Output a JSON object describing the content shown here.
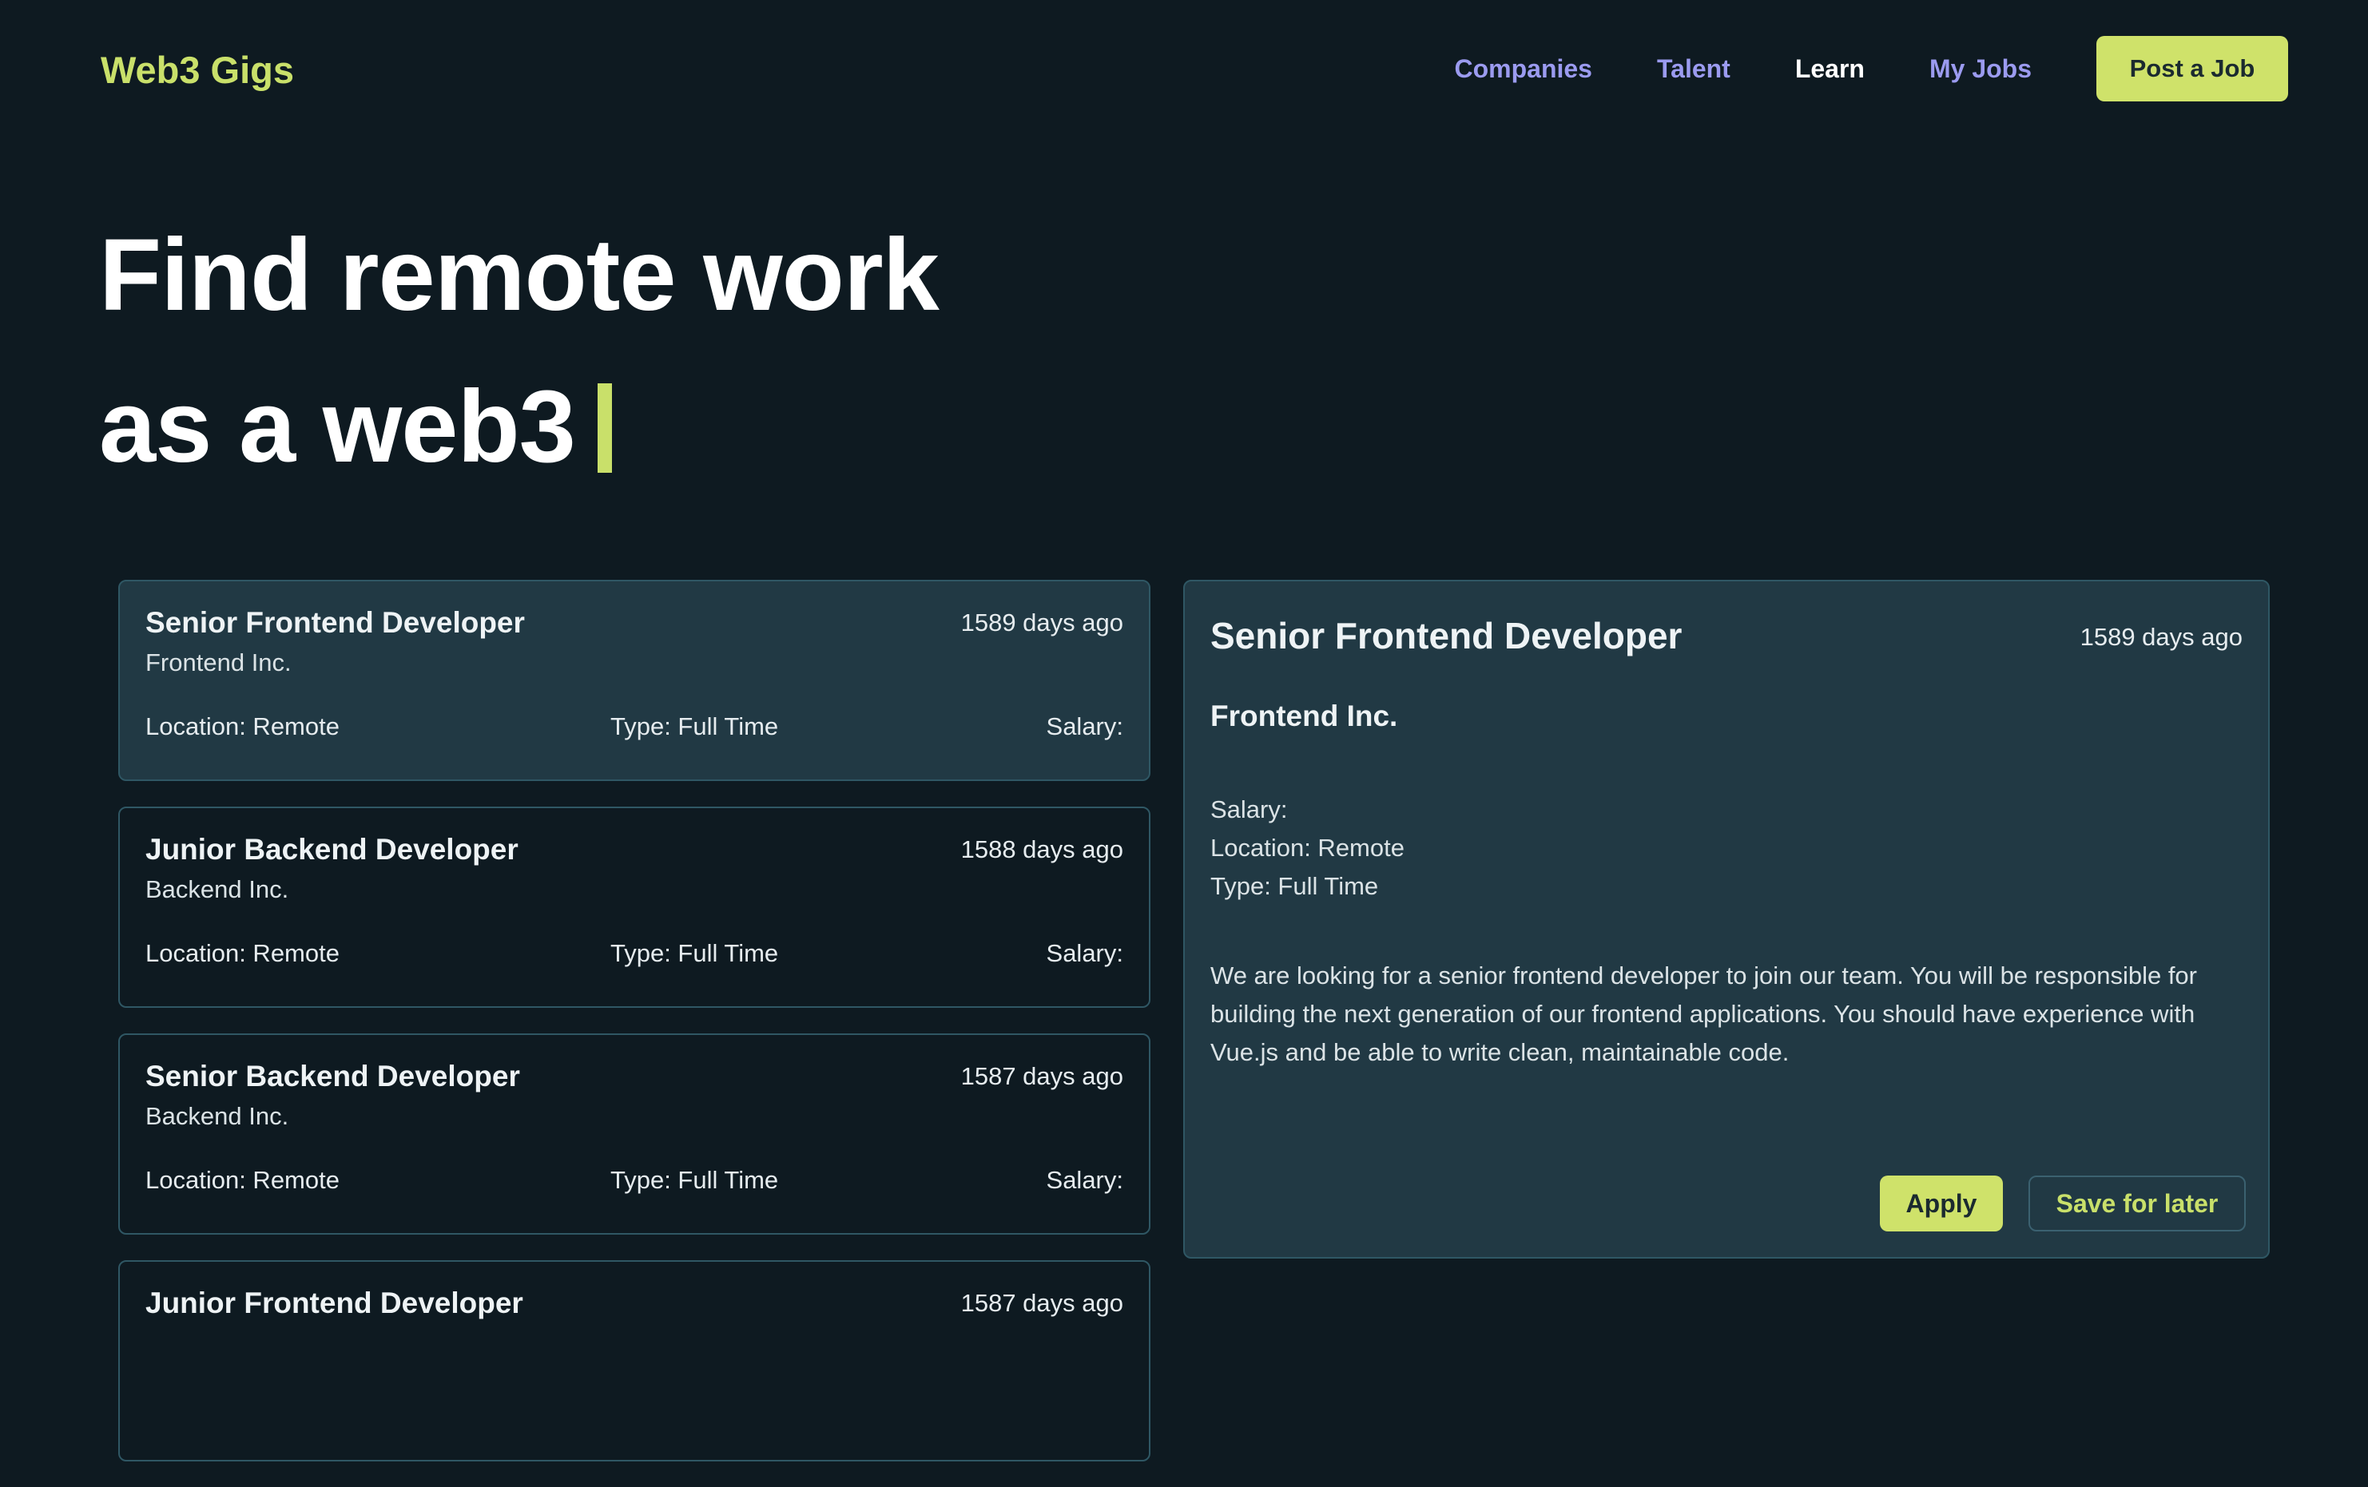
{
  "brand": "Web3 Gigs",
  "nav": {
    "links": [
      {
        "label": "Companies",
        "active": false
      },
      {
        "label": "Talent",
        "active": false
      },
      {
        "label": "Learn",
        "active": true
      },
      {
        "label": "My Jobs",
        "active": false
      }
    ],
    "cta": "Post a Job"
  },
  "hero": {
    "line1": "Find remote work",
    "line2": "as a web3"
  },
  "jobs": [
    {
      "title": "Senior Frontend Developer",
      "age": "1589 days ago",
      "company": "Frontend Inc.",
      "location": "Location: Remote",
      "type": "Type: Full Time",
      "salary": "Salary:",
      "selected": true
    },
    {
      "title": "Junior Backend Developer",
      "age": "1588 days ago",
      "company": "Backend Inc.",
      "location": "Location: Remote",
      "type": "Type: Full Time",
      "salary": "Salary:",
      "selected": false
    },
    {
      "title": "Senior Backend Developer",
      "age": "1587 days ago",
      "company": "Backend Inc.",
      "location": "Location: Remote",
      "type": "Type: Full Time",
      "salary": "Salary:",
      "selected": false
    },
    {
      "title": "Junior Frontend Developer",
      "age": "1587 days ago",
      "company": "",
      "location": "",
      "type": "",
      "salary": "",
      "selected": false
    }
  ],
  "detail": {
    "title": "Senior Frontend Developer",
    "age": "1589 days ago",
    "company": "Frontend Inc.",
    "salary": "Salary:",
    "location": "Location: Remote",
    "type": "Type: Full Time",
    "description": "We are looking for a senior frontend developer to join our team. You will be responsible for building the next generation of our frontend applications. You should have experience with Vue.js and be able to write clean, maintainable code.",
    "apply_label": "Apply",
    "save_label": "Save for later"
  },
  "colors": {
    "background": "#0e1a21",
    "accent": "#cfe26a",
    "nav_link": "#9b9bf0",
    "card_selected": "#213944",
    "border": "#2f5764"
  }
}
